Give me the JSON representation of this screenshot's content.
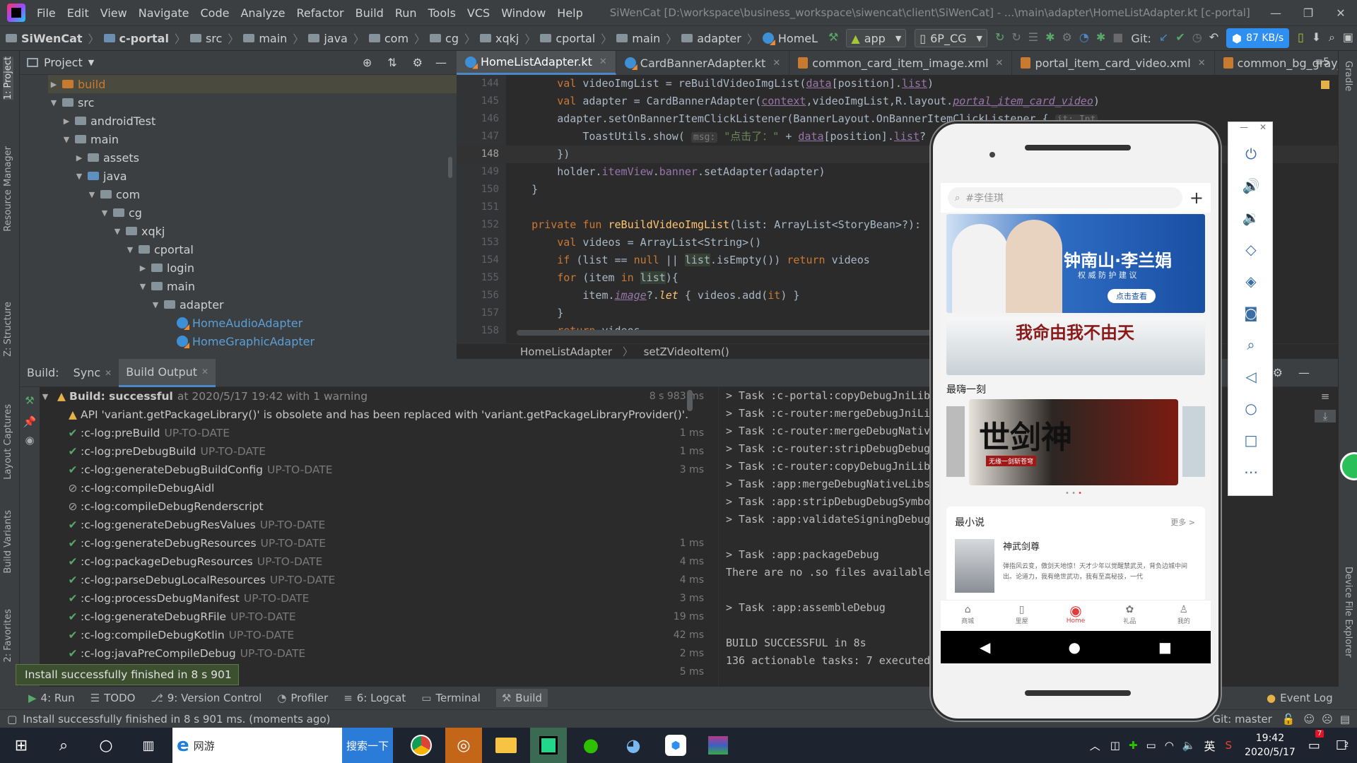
{
  "ide": {
    "menu": [
      "File",
      "Edit",
      "View",
      "Navigate",
      "Code",
      "Analyze",
      "Refactor",
      "Build",
      "Run",
      "Tools",
      "VCS",
      "Window",
      "Help"
    ],
    "window_title": "SiWenCat [D:\\workspace\\business_workspace\\siwencat\\client\\SiWenCat] - ...\\main\\adapter\\HomeListAdapter.kt [c-portal]",
    "breadcrumbs": [
      "SiWenCat",
      "c-portal",
      "src",
      "main",
      "java",
      "com",
      "cg",
      "xqkj",
      "cportal",
      "main",
      "adapter",
      "HomeL"
    ],
    "run_config": "app",
    "device": "6P_CG",
    "git_label": "Git:",
    "network_speed": "87 KB/s",
    "project_panel_title": "Project",
    "left_strip": [
      "1: Project",
      "Resource Manager",
      "Z: Structure",
      "Layout Captures",
      "Build Variants",
      "2: Favorites"
    ],
    "right_strip": [
      "Gradle",
      "Device File Explorer"
    ],
    "tree": [
      {
        "label": "build",
        "indent": 0,
        "arrow": "▶",
        "type": "orange"
      },
      {
        "label": "src",
        "indent": 0,
        "arrow": "▼",
        "type": "folder"
      },
      {
        "label": "androidTest",
        "indent": 1,
        "arrow": "▶",
        "type": "folder"
      },
      {
        "label": "main",
        "indent": 1,
        "arrow": "▼",
        "type": "folder"
      },
      {
        "label": "assets",
        "indent": 2,
        "arrow": "▶",
        "type": "folder"
      },
      {
        "label": "java",
        "indent": 2,
        "arrow": "▼",
        "type": "blue"
      },
      {
        "label": "com",
        "indent": 3,
        "arrow": "▼",
        "type": "folder"
      },
      {
        "label": "cg",
        "indent": 4,
        "arrow": "▼",
        "type": "folder"
      },
      {
        "label": "xqkj",
        "indent": 5,
        "arrow": "▼",
        "type": "folder"
      },
      {
        "label": "cportal",
        "indent": 6,
        "arrow": "▼",
        "type": "folder"
      },
      {
        "label": "login",
        "indent": 7,
        "arrow": "▶",
        "type": "folder"
      },
      {
        "label": "main",
        "indent": 7,
        "arrow": "▼",
        "type": "folder"
      },
      {
        "label": "adapter",
        "indent": 8,
        "arrow": "▼",
        "type": "folder"
      },
      {
        "label": "HomeAudioAdapter",
        "indent": 9,
        "arrow": "",
        "type": "kt"
      },
      {
        "label": "HomeGraphicAdapter",
        "indent": 9,
        "arrow": "",
        "type": "kt"
      }
    ],
    "editor_tabs": [
      {
        "label": "HomeListAdapter.kt",
        "type": "kt",
        "active": true
      },
      {
        "label": "CardBannerAdapter.kt",
        "type": "kt",
        "active": false
      },
      {
        "label": "common_card_item_image.xml",
        "type": "xml",
        "active": false
      },
      {
        "label": "portal_item_card_video.xml",
        "type": "xml",
        "active": false
      },
      {
        "label": "common_bg_gray_circle",
        "type": "xml",
        "active": false
      }
    ],
    "tabs_overflow": "≡5",
    "line_numbers": [
      "144",
      "145",
      "146",
      "147",
      "148",
      "149",
      "150",
      "151",
      "152",
      "153",
      "154",
      "155",
      "156",
      "157",
      "158"
    ],
    "editor_breadcrumb": [
      "HomeListAdapter",
      "setZVideoItem()"
    ],
    "build_tabs": [
      "Build:",
      "Sync",
      "Build Output"
    ],
    "build_summary": {
      "status": "Build: successful",
      "detail": "at 2020/5/17 19:42 with 1 warning",
      "time": "8 s 983 ms"
    },
    "build_warning": "API 'variant.getPackageLibrary()' is obsolete and has been replaced with 'variant.getPackageLibraryProvider()'.",
    "build_rows": [
      {
        "icon": "ok",
        "task": ":c-log:preBuild",
        "state": "UP-TO-DATE",
        "ms": "1 ms"
      },
      {
        "icon": "ok",
        "task": ":c-log:preDebugBuild",
        "state": "UP-TO-DATE",
        "ms": "1 ms"
      },
      {
        "icon": "ok",
        "task": ":c-log:generateDebugBuildConfig",
        "state": "UP-TO-DATE",
        "ms": "3 ms"
      },
      {
        "icon": "skip",
        "task": ":c-log:compileDebugAidl",
        "state": "",
        "ms": ""
      },
      {
        "icon": "skip",
        "task": ":c-log:compileDebugRenderscript",
        "state": "",
        "ms": ""
      },
      {
        "icon": "ok",
        "task": ":c-log:generateDebugResValues",
        "state": "UP-TO-DATE",
        "ms": ""
      },
      {
        "icon": "ok",
        "task": ":c-log:generateDebugResources",
        "state": "UP-TO-DATE",
        "ms": "1 ms"
      },
      {
        "icon": "ok",
        "task": ":c-log:packageDebugResources",
        "state": "UP-TO-DATE",
        "ms": "4 ms"
      },
      {
        "icon": "ok",
        "task": ":c-log:parseDebugLocalResources",
        "state": "UP-TO-DATE",
        "ms": "4 ms"
      },
      {
        "icon": "ok",
        "task": ":c-log:processDebugManifest",
        "state": "UP-TO-DATE",
        "ms": "3 ms"
      },
      {
        "icon": "ok",
        "task": ":c-log:generateDebugRFile",
        "state": "UP-TO-DATE",
        "ms": "19 ms"
      },
      {
        "icon": "ok",
        "task": ":c-log:compileDebugKotlin",
        "state": "UP-TO-DATE",
        "ms": "42 ms"
      },
      {
        "icon": "ok",
        "task": ":c-log:javaPreCompileDebug",
        "state": "UP-TO-DATE",
        "ms": "2 ms"
      },
      {
        "icon": "ok",
        "task": "hJavac",
        "state": "UP-TO-DATE",
        "ms": "5 ms"
      }
    ],
    "console_lines": [
      "> Task :c-portal:copyDebugJniLibsP",
      "> Task :c-router:mergeDebugJniLibFo",
      "> Task :c-router:mergeDebugNativeLi",
      "> Task :c-router:stripDebugDebugSym",
      "> Task :c-router:copyDebugJniLibsPr",
      "> Task :app:mergeDebugNativeLibs UP",
      "> Task :app:stripDebugDebugSymbols U",
      "> Task :app:validateSigningDebug UP",
      "",
      "> Task :app:packageDebug",
      "There are no .so files available to",
      "",
      "> Task :app:assembleDebug",
      "",
      "BUILD SUCCESSFUL in 8s",
      "136 actionable tasks: 7 executed, 1"
    ],
    "tooltip": "Install successfully finished in 8 s 901 ms.",
    "bottom_tools": [
      "4: Run",
      "TODO",
      "9: Version Control",
      "Profiler",
      "6: Logcat",
      "Terminal",
      "Build"
    ],
    "event_log": "Event Log",
    "status_text": "Install successfully finished in 8 s 901 ms. (moments ago)",
    "git_branch": "Git: master"
  },
  "phone_app": {
    "search_placeholder": "#李佳琪",
    "banner_title": "钟南山·李兰娟",
    "banner_subtitle": "权 威 防 护 建 议",
    "banner_button": "点击查看",
    "banner2_text": "我命由我不由天",
    "section1": "最嗨一刻",
    "card_title": "世剑神",
    "card_sub": "无缘一剑斩苍穹",
    "section2": "最小说",
    "more": "更多 >",
    "novel_title": "神武剑尊",
    "novel_desc": "弹指风云变，傲剑天地惊！天才少年以觉醒禁武灵，背负边城中间出。论道力，我有绝世武功，我有至高秘技，一代",
    "nav": [
      "商城",
      "里屋",
      "Home",
      "礼品",
      "我的"
    ]
  },
  "taskbar": {
    "search_text": "网游",
    "search_button": "搜索一下",
    "time": "19:42",
    "date": "2020/5/17",
    "ime": "英",
    "notif_count": "7",
    "notif_badge2": "2"
  },
  "colors": {
    "accent": "#4a88c7",
    "ok": "#59a869",
    "warn": "#e5b24a",
    "phone_nav_active": "#e23b3b"
  }
}
